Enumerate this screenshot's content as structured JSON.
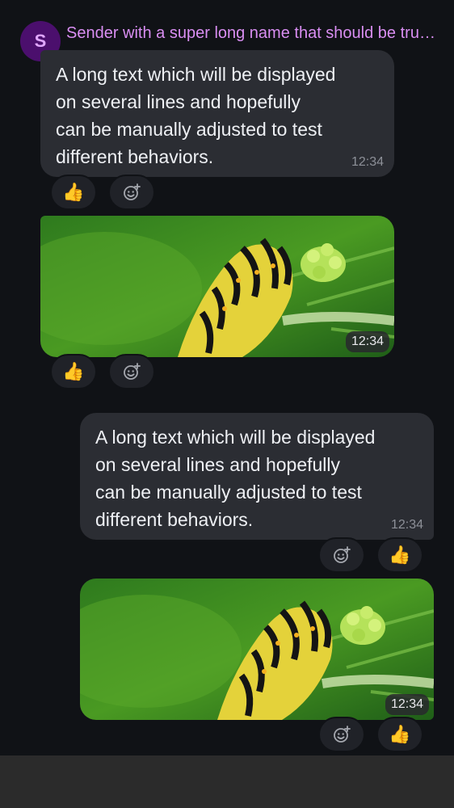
{
  "sender": {
    "initial": "S",
    "name": "Sender with a super long name that should be truncated"
  },
  "messages": [
    {
      "kind": "text",
      "direction": "incoming",
      "text": "A long text which will be displayed\non several lines and hopefully\ncan be manually adjusted to test\ndifferent behaviors.",
      "time": "12:34",
      "reaction": "👍"
    },
    {
      "kind": "image",
      "direction": "incoming",
      "time": "12:34",
      "reaction": "👍"
    },
    {
      "kind": "text",
      "direction": "outgoing",
      "text": "A long text which will be displayed\non several lines and hopefully\ncan be manually adjusted to test\ndifferent behaviors.",
      "time": "12:34",
      "reaction": "👍"
    },
    {
      "kind": "image",
      "direction": "outgoing",
      "time": "12:34",
      "reaction": "👍"
    }
  ],
  "icons": {
    "add_reaction": "add-reaction-icon",
    "thumbs_up": "thumbs-up-emoji"
  },
  "colors": {
    "background": "#101216",
    "bubble": "#2b2d33",
    "sender_name": "#d98ef2",
    "avatar_bg": "#4b0f6d",
    "avatar_text": "#e0a6ff"
  }
}
